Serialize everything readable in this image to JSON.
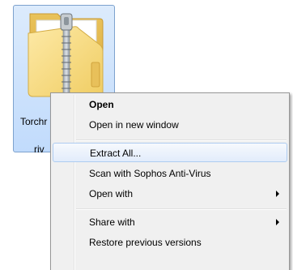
{
  "file": {
    "name_line1": "Torchr",
    "name_line2": "riv",
    "icon": "zipped-folder-icon"
  },
  "menu": {
    "items": [
      {
        "label": "Open",
        "bold": true
      },
      {
        "label": "Open in new window"
      },
      {
        "label": "Extract All...",
        "highlighted": true
      },
      {
        "label": "Scan with Sophos Anti-Virus"
      },
      {
        "label": "Open with",
        "submenu": true
      },
      {
        "label": "Share with",
        "submenu": true
      },
      {
        "label": "Restore previous versions"
      }
    ]
  },
  "colors": {
    "selection_fill": "#c1dbfc",
    "selection_border": "#7da2ce",
    "menu_background": "#f0f0f0",
    "menu_highlight_border": "#aeccf1",
    "folder_yellow": "#f3d26c"
  }
}
